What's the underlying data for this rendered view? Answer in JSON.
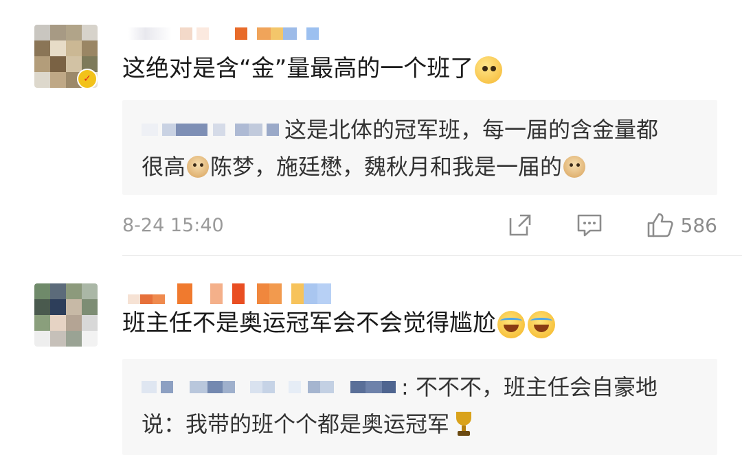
{
  "comments": [
    {
      "text": "这绝对是含“金”量最高的一个班了",
      "text_emoji": "thinking-emoji",
      "reply_line1": "这是北体的冠军班，每一届的含金量都",
      "reply_line2_a": "很高",
      "reply_line2_b": "陈梦，施廷懋，魏秋月和我是一届的",
      "reply_emoji": "doge-emoji",
      "time": "8-24 15:40",
      "likes": "586",
      "actions": [
        "share-icon",
        "comment-icon",
        "like-icon"
      ]
    },
    {
      "text": "班主任不是奥运冠军会不会觉得尴尬",
      "text_emoji": "laugh-cry-emoji",
      "reply_line1": ": 不不不，班主任会自豪地",
      "reply_line2_a": "说：我带的班个个都是奥运冠军",
      "reply_emoji": "trophy-emoji"
    }
  ],
  "colors": {
    "reply_bg": "#f7f7f7",
    "meta_text": "#9a9a9a",
    "divider": "#eaeaea"
  }
}
